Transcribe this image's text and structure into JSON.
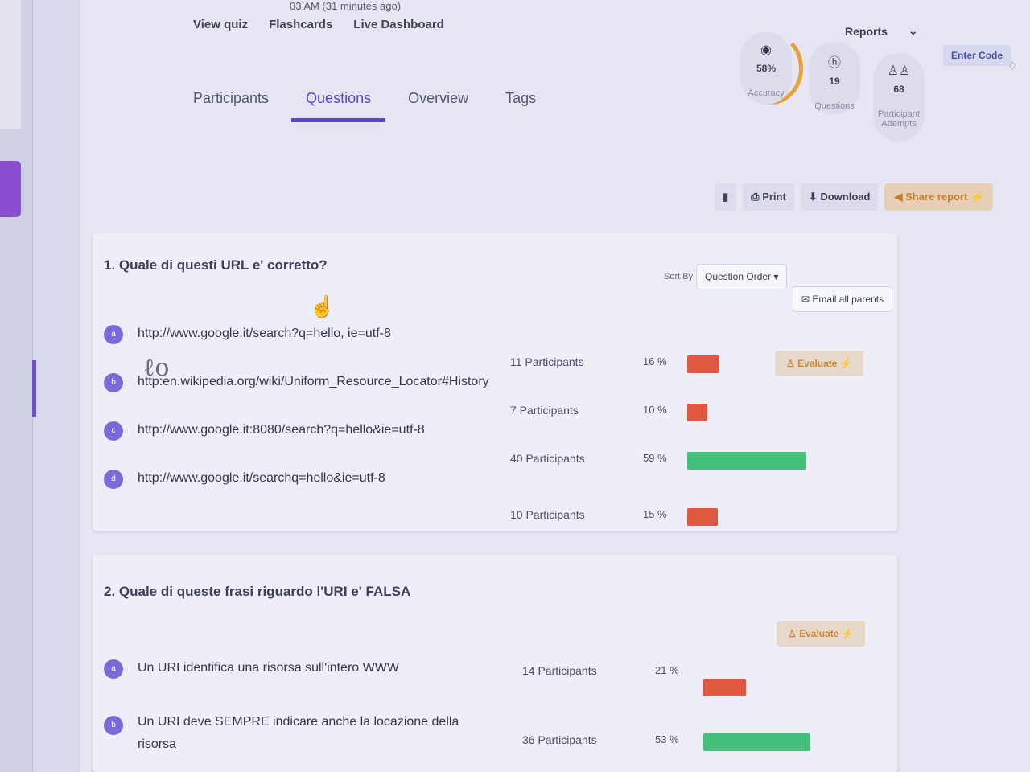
{
  "header": {
    "timestamp": "03 AM (31 minutes ago)",
    "quick_links": [
      "View quiz",
      "Flashcards",
      "Live Dashboard"
    ],
    "reports_label": "Reports",
    "enter_code_label": "Enter Code"
  },
  "tabs": [
    {
      "label": "Participants",
      "active": false
    },
    {
      "label": "Questions",
      "active": true
    },
    {
      "label": "Overview",
      "active": false
    },
    {
      "label": "Tags",
      "active": false
    }
  ],
  "stats": {
    "accuracy": {
      "value": "58%",
      "label": "Accuracy",
      "icon": "target-icon"
    },
    "questions": {
      "value": "19",
      "label": "Questions",
      "icon": "question-icon"
    },
    "attempts": {
      "value": "68",
      "label": "Participant Attempts",
      "icon": "group-icon"
    }
  },
  "actions": {
    "print_label": "Print",
    "download_label": "Download",
    "share_label": "Share report"
  },
  "sort": {
    "label": "Sort By",
    "selected": "Question Order",
    "email_label": "Email all parents"
  },
  "evaluate_label": "Evaluate",
  "questions": [
    {
      "title": "1. Quale di questi URL e' corretto?",
      "options": [
        {
          "badge": "a",
          "text": "http://www.google.it/search?q=hello, ie=utf-8",
          "participants": "11 Participants",
          "percent": "16 %",
          "fraction": 0.16,
          "correct": false
        },
        {
          "badge": "b",
          "text": "http:en.wikipedia.org/wiki/Uniform_Resource_Locator#History",
          "participants": "7 Participants",
          "percent": "10 %",
          "fraction": 0.1,
          "correct": false
        },
        {
          "badge": "c",
          "text": "http://www.google.it:8080/search?q=hello&ie=utf-8",
          "participants": "40 Participants",
          "percent": "59 %",
          "fraction": 0.59,
          "correct": true
        },
        {
          "badge": "d",
          "text": "http://www.google.it/searchq=hello&ie=utf-8",
          "participants": "10 Participants",
          "percent": "15 %",
          "fraction": 0.15,
          "correct": false
        }
      ]
    },
    {
      "title": "2. Quale di queste frasi riguardo l'URI e' FALSA",
      "options": [
        {
          "badge": "a",
          "text": "Un URI identifica una risorsa sull'intero WWW",
          "participants": "14 Participants",
          "percent": "21 %",
          "fraction": 0.21,
          "correct": false
        },
        {
          "badge": "b",
          "text": "Un URI deve SEMPRE indicare anche la locazione della risorsa",
          "participants": "36 Participants",
          "percent": "53 %",
          "fraction": 0.53,
          "correct": true
        }
      ]
    }
  ],
  "colors": {
    "accent": "#5b43d6",
    "wrong": "#e0583f",
    "correct": "#43c079",
    "share": "#c77c2c"
  }
}
